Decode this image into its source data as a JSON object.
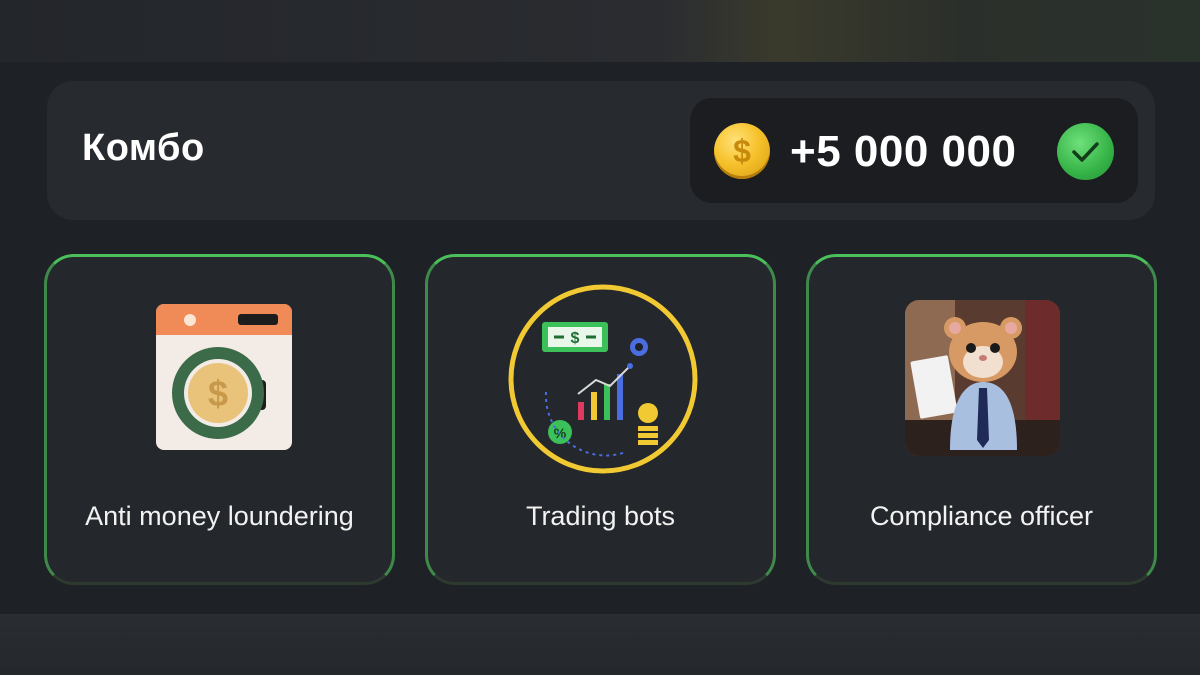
{
  "combo": {
    "title": "Комбо",
    "reward": "+5 000 000",
    "coin_icon": "dollar-coin-icon",
    "status_icon": "check-circle-icon",
    "accent_color": "#4bbf5a"
  },
  "cards": [
    {
      "label": "Anti money loundering",
      "icon": "washing-machine-dollar-icon"
    },
    {
      "label": "Trading bots",
      "icon": "trading-chart-icon"
    },
    {
      "label": "Compliance officer",
      "icon": "hamster-officer-image"
    }
  ]
}
